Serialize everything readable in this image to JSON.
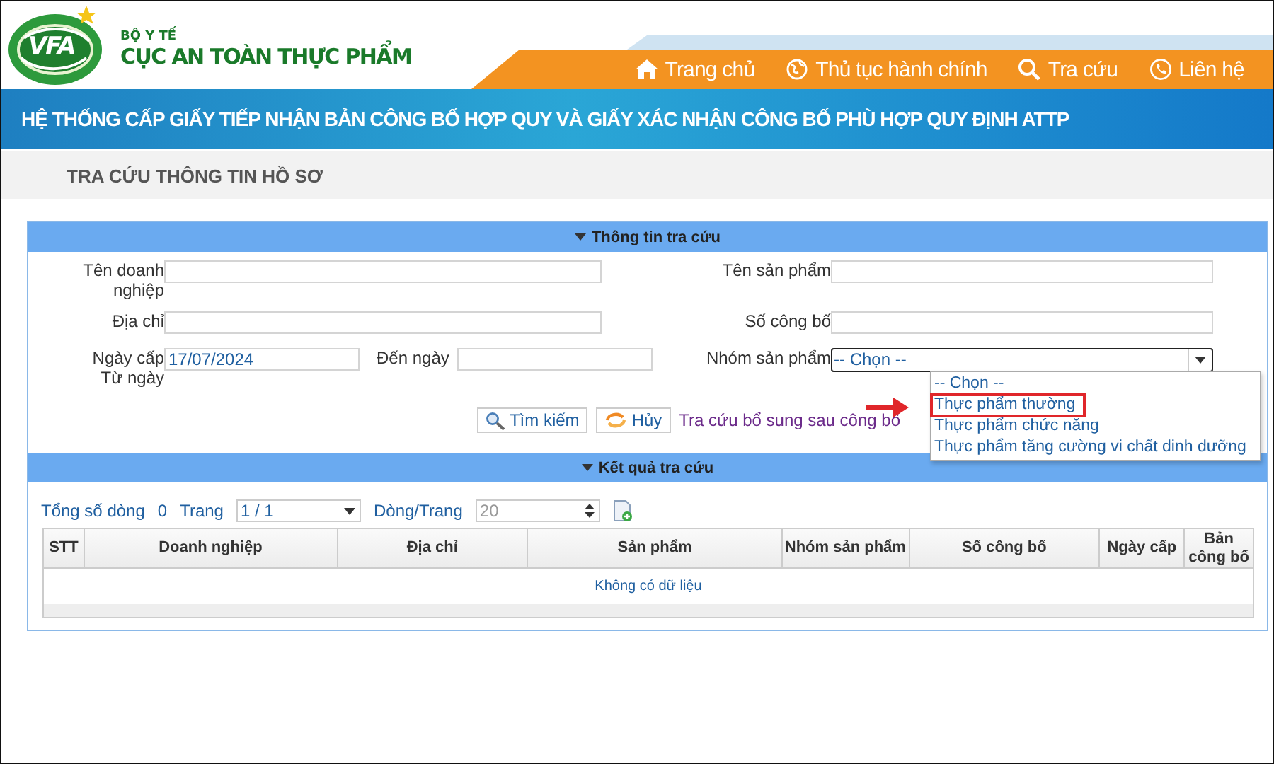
{
  "header": {
    "logo_text": "VFA",
    "ministry": "BỘ Y TẾ",
    "agency": "CỤC AN TOÀN THỰC PHẨM",
    "nav": [
      {
        "label": "Trang chủ"
      },
      {
        "label": "Thủ tục hành chính"
      },
      {
        "label": "Tra cứu"
      },
      {
        "label": "Liên hệ"
      }
    ]
  },
  "banner_title": "HỆ THỐNG CẤP GIẤY TIẾP NHẬN BẢN CÔNG BỐ HỢP QUY VÀ GIẤY XÁC NHẬN CÔNG BỐ PHÙ HỢP QUY ĐỊNH ATTP",
  "breadcrumb": "TRA CỨU THÔNG TIN HỒ SƠ",
  "search_panel": {
    "title": "Thông tin tra cứu",
    "company_name": {
      "label": "Tên doanh nghiệp"
    },
    "product_name": {
      "label": "Tên sản phẩm"
    },
    "address": {
      "label": "Địa chỉ"
    },
    "announcement_number": {
      "label": "Số công bố"
    },
    "issue_date_from": {
      "label": "Ngày cấp Từ ngày",
      "value": "17/07/2024"
    },
    "issue_date_to": {
      "label": "Đến ngày"
    },
    "product_group": {
      "label": "Nhóm sản phẩm",
      "value": "-- Chọn --",
      "expanded": true,
      "options": [
        {
          "label": "-- Chọn --",
          "highlighted": false
        },
        {
          "label": "Thực phẩm thường",
          "highlighted": true
        },
        {
          "label": "Thực phẩm chức năng",
          "highlighted": false
        },
        {
          "label": "Thực phẩm tăng cường vi chất dinh dưỡng",
          "highlighted": false
        }
      ]
    },
    "buttons": [
      {
        "label": "Tìm kiếm"
      },
      {
        "label": "Hủy"
      }
    ],
    "supplement_link": "Tra cứu bổ sung sau công bố"
  },
  "results_panel": {
    "title": "Kết quả tra cứu",
    "total_label": "Tổng số dòng",
    "total": "0",
    "page_label": "Trang",
    "page": "1 / 1",
    "rows_per_page_label": "Dòng/Trang",
    "rows_per_page": "20",
    "columns": [
      "STT",
      "Doanh nghiệp",
      "Địa chỉ",
      "Sản phẩm",
      "Nhóm sản phẩm",
      "Số công bố",
      "Ngày cấp",
      "Bản công bố"
    ],
    "empty_message": "Không có dữ liệu"
  }
}
